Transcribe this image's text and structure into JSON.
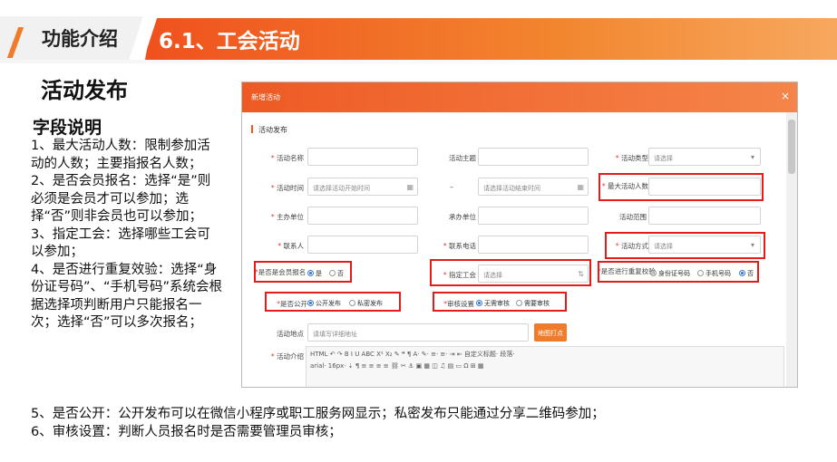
{
  "header": {
    "tab_label": "功能介绍",
    "title": "6.1、工会活动"
  },
  "section_title": "活动发布",
  "fields_heading": "字段说明",
  "description": [
    "1、最大活动人数：限制参加活动的人数；主要指报名人数；",
    "2、是否会员报名：选择“是”则必须是会员才可以参加；选择“否”则非会员也可以参加；",
    "3、指定工会：选择哪些工会可以参加；",
    "4、是否进行重复效验：选择“身份证号码”、“手机号码”系统会根据选择项判断用户只能报名一次；选择“否”可以多次报名；"
  ],
  "description_wide": [
    "5、是否公开：公开发布可以在微信小程序或职工服务网显示；私密发布只能通过分享二维码参加；",
    "6、审核设置：判断人员报名时是否需要管理员审核；"
  ],
  "form": {
    "window_title": "新增活动",
    "close_glyph": "×",
    "section": "活动发布",
    "labels": {
      "activity_name": "活动名称",
      "activity_theme": "活动主题",
      "activity_type": "活动类型",
      "activity_time": "活动时间",
      "time_sep": "–",
      "max_people": "最大活动人数",
      "organizer": "主办单位",
      "co_organizer": "承办单位",
      "activity_scope": "活动范围",
      "contact": "联系人",
      "contact_phone": "联系电话",
      "activity_mode": "活动方式",
      "member_only": "是否是会员报名",
      "assigned_union": "指定工会",
      "dup_check": "是否进行重复校验",
      "public": "是否公开",
      "review": "审核设置",
      "location": "活动地点",
      "intro": "活动介绍"
    },
    "placeholders": {
      "activity_type": "请选择",
      "start_time": "请选择活动开始时间",
      "end_time": "请选择活动结束时间",
      "activity_mode": "请选择",
      "assigned_union": "请选择",
      "location": "请填写详细地址"
    },
    "options": {
      "yes": "是",
      "no": "否",
      "id_card": "身份证号码",
      "phone": "手机号码",
      "dup_no": "否",
      "public_yes": "公开发布",
      "public_private": "私密发布",
      "review_none": "无需审核",
      "review_need": "需要审核"
    },
    "map_button": "地图打点",
    "toolbar": {
      "row1": "HTML  ↶ ↷  B I U ABC X² X₂ ✎ ❝ ¶  A· ✎·  ≡· ≡· ⇥ ⇤  自定义标题·  段落·",
      "row2": "arial·  16px·  ⇣ ¶  ≡ ≡ ≡ ≡  ⛓ ✂  ⚓  ▣ ▦ ◫  ♫  ▤  ▭  Ω  ⊞ ▦"
    }
  }
}
